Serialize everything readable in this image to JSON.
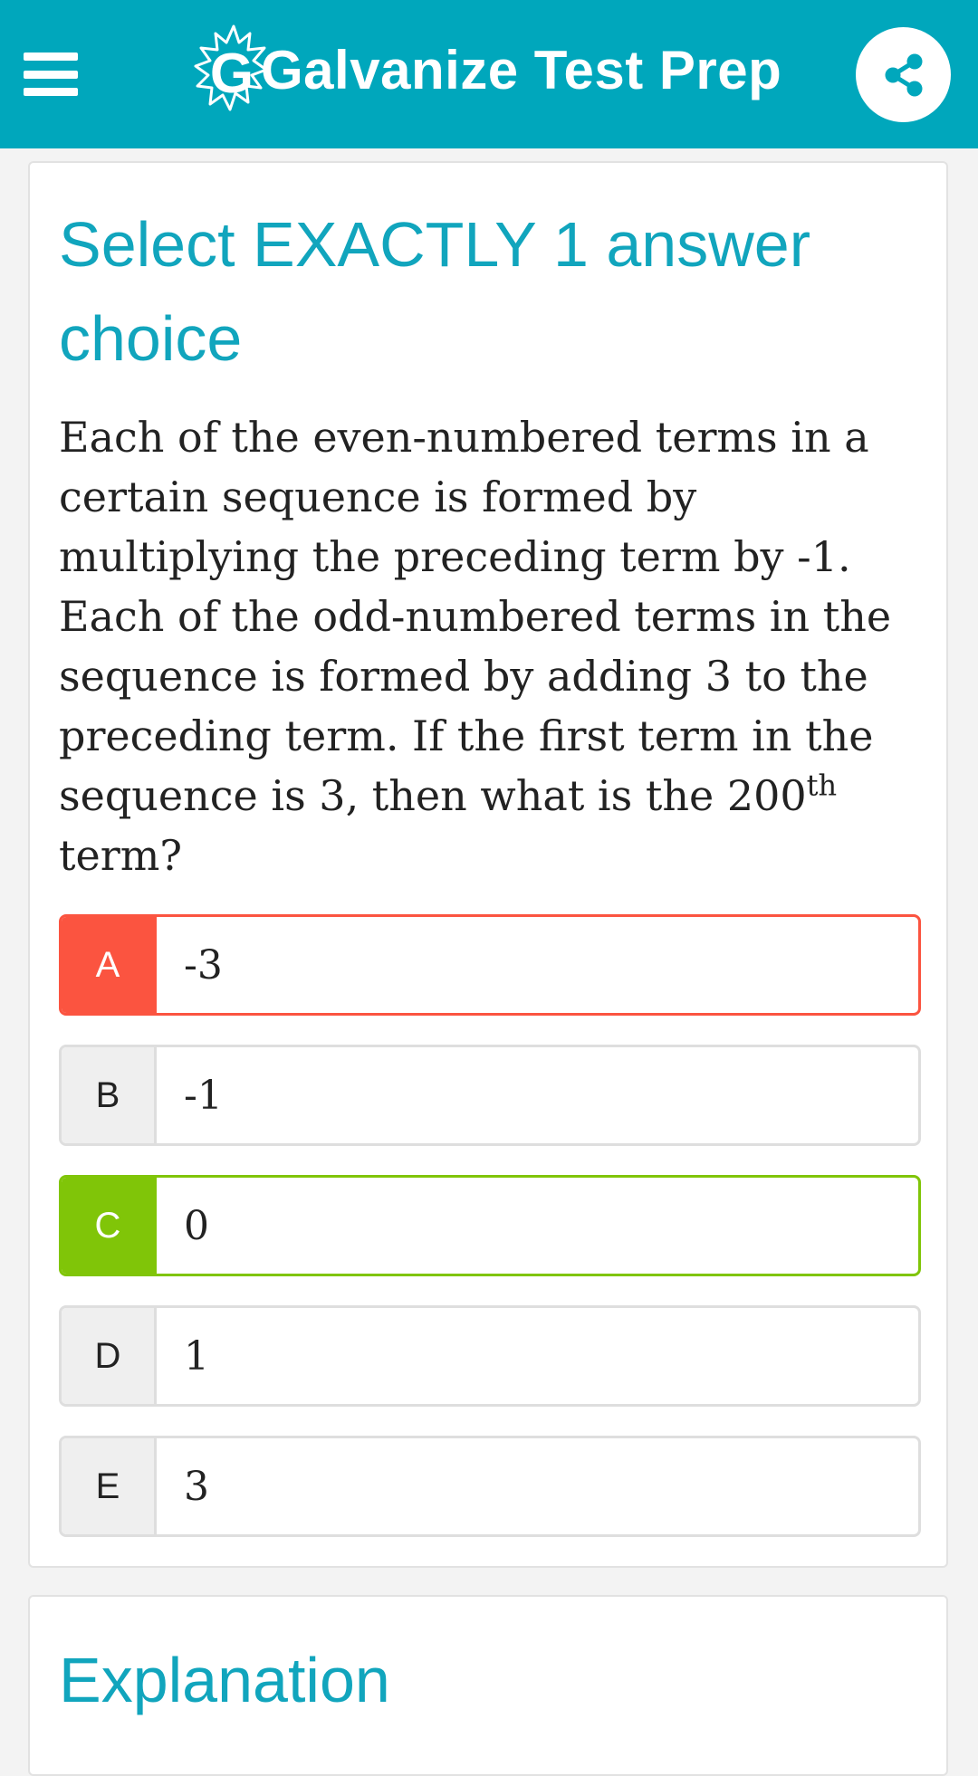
{
  "header": {
    "title": "Galvanize Test Prep",
    "brand_color": "#00a7bc",
    "menu_icon": "hamburger-menu-icon",
    "share_icon": "share-icon"
  },
  "question": {
    "instruction": "Select EXACTLY 1 answer choice",
    "text_before": "Each of the even-numbered terms in a certain sequence is formed by multiplying the preceding term by -1. Each of the odd-numbered terms in the sequence is formed by adding 3 to the preceding term. If the first term in the sequence is 3, then what is the 200",
    "superscript": "th",
    "text_after": " term?"
  },
  "choices": [
    {
      "letter": "A",
      "value": "-3",
      "state": "wrong",
      "color": "#fb5440"
    },
    {
      "letter": "B",
      "value": "-1",
      "state": "neutral"
    },
    {
      "letter": "C",
      "value": "0",
      "state": "correct",
      "color": "#80c508"
    },
    {
      "letter": "D",
      "value": "1",
      "state": "neutral"
    },
    {
      "letter": "E",
      "value": "3",
      "state": "neutral"
    }
  ],
  "explanation": {
    "heading": "Explanation"
  }
}
